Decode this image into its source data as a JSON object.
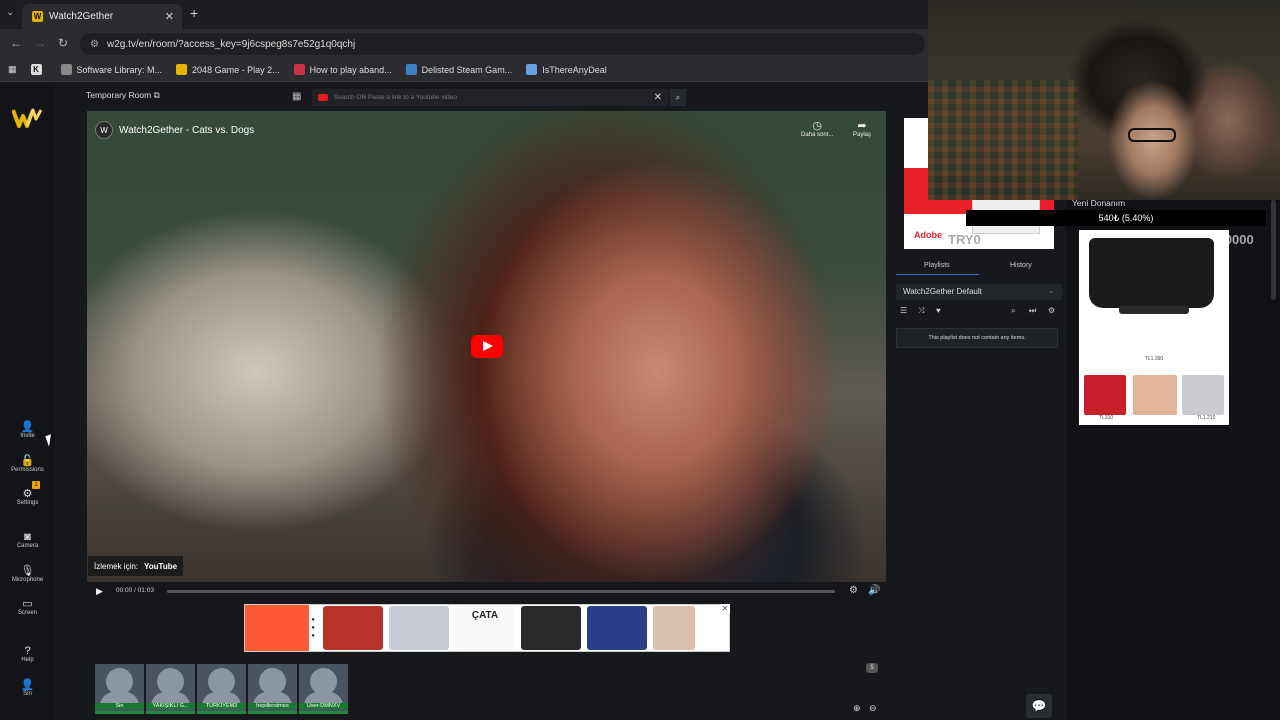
{
  "browser": {
    "tab_title": "Watch2Gether",
    "url": "w2g.tv/en/room/?access_key=9j6cspeg8s7e52g1q0qchj",
    "bookmarks": [
      {
        "label": "Software Library: M...",
        "color": "#888888"
      },
      {
        "label": "2048 Game - Play 2...",
        "color": "#e6b400"
      },
      {
        "label": "How to play aband...",
        "color": "#cc3344"
      },
      {
        "label": "Delisted Steam Gam...",
        "color": "#3b82c4"
      },
      {
        "label": "IsThereAnyDeal",
        "color": "#6aa0e0"
      }
    ]
  },
  "nav": {
    "invite": "Invite",
    "permissions": "Permissions",
    "settings": "Settings",
    "settings_badge": "1",
    "camera": "Camera",
    "microphone": "Microphone",
    "screen": "Screen",
    "help": "Help",
    "user": "Sin"
  },
  "room": {
    "name": "Temporary Room",
    "search_placeholder": "Search OR Paste a link to a Youtube video"
  },
  "video": {
    "title": "Watch2Gether - Cats vs. Dogs",
    "watch_later": "Daha sonr...",
    "share": "Paylaş",
    "watch_on": "İzlemek için:",
    "youtube": "YouTube",
    "time": "00:00 / 01:03"
  },
  "users": [
    {
      "name": "Sin"
    },
    {
      "name": "YAKIŞIKLI G..."
    },
    {
      "name": "TURKIYEM3"
    },
    {
      "name": "hepillerstmes"
    },
    {
      "name": "User-DMNXV"
    }
  ],
  "user_count": "5",
  "playlist": {
    "tab_playlists": "Playlists",
    "tab_history": "History",
    "selected": "Watch2Gether Default",
    "empty_message": "This playlist does not contain any items."
  },
  "ads": {
    "adobe_text": "Do\nbir",
    "adobe_brand": "Adobe",
    "ticker_label": "Yeni Donanım",
    "ticker_pct": "540₺ (5.40%)",
    "try_left": "TRY0",
    "try_right": "TRY10000",
    "product_price": "TL1.390",
    "price_a": "TL310",
    "price_b": "TL1.210",
    "banner_brand": "ÇATA"
  },
  "colors": {
    "accent": "#3a6cd8",
    "user_green": "#177a30",
    "youtube_red": "#ff0000",
    "ad_orange": "#ff5a36"
  }
}
